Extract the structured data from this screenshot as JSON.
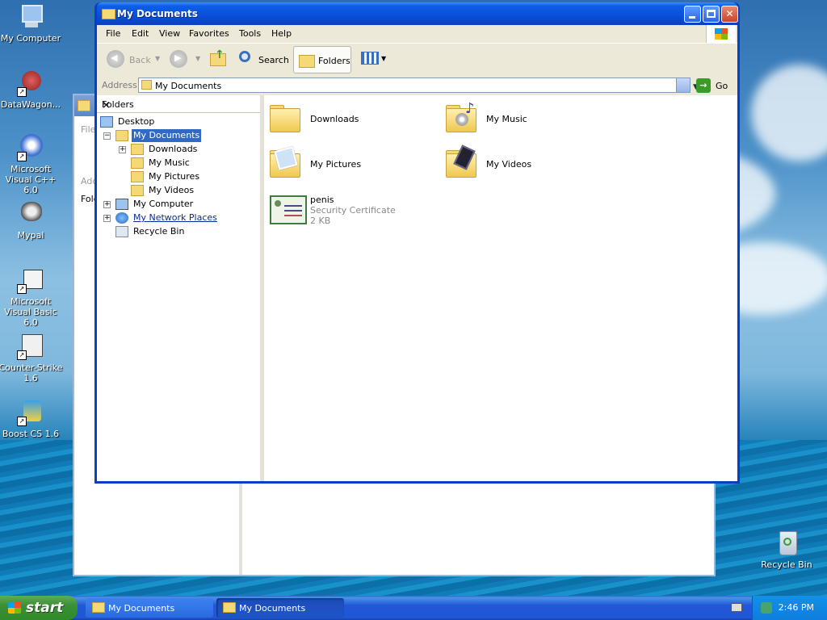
{
  "desktop": {
    "icons": [
      {
        "label": "My Computer"
      },
      {
        "label": "DataWagon..."
      },
      {
        "label": "Microsoft Visual C++ 6.0"
      },
      {
        "label": "Mypal"
      },
      {
        "label": "Microsoft Visual Basic 6.0"
      },
      {
        "label": "Counter-Strike 1.6"
      },
      {
        "label": "Boost CS 1.6"
      }
    ],
    "recycle_bin": "Recycle Bin"
  },
  "back_window": {
    "fragments": [
      "File",
      "Add",
      "Fold"
    ]
  },
  "window": {
    "title": "My Documents",
    "menu": [
      "File",
      "Edit",
      "View",
      "Favorites",
      "Tools",
      "Help"
    ],
    "toolbar": {
      "back": "Back",
      "search": "Search",
      "folders": "Folders"
    },
    "address": {
      "label": "Address",
      "value": "My Documents",
      "go": "Go"
    },
    "folders_pane": {
      "title": "Folders",
      "close": "×",
      "tree": [
        {
          "label": "Desktop"
        },
        {
          "label": "My Documents"
        },
        {
          "label": "Downloads"
        },
        {
          "label": "My Music"
        },
        {
          "label": "My Pictures"
        },
        {
          "label": "My Videos"
        },
        {
          "label": "My Computer"
        },
        {
          "label": "My Network Places"
        },
        {
          "label": "Recycle Bin"
        }
      ]
    },
    "files": [
      {
        "name": "Downloads"
      },
      {
        "name": "My Music"
      },
      {
        "name": "My Pictures"
      },
      {
        "name": "My Videos"
      },
      {
        "name": "penis",
        "type": "Security Certificate",
        "size": "2 KB"
      }
    ]
  },
  "taskbar": {
    "start": "start",
    "tasks": [
      "My Documents",
      "My Documents"
    ],
    "clock": "2:46 PM"
  },
  "colors": {
    "titlebar": "#0a4fd8",
    "selection": "#316ac5",
    "start_green": "#3c8f37",
    "taskbar_blue": "#2157d7"
  }
}
